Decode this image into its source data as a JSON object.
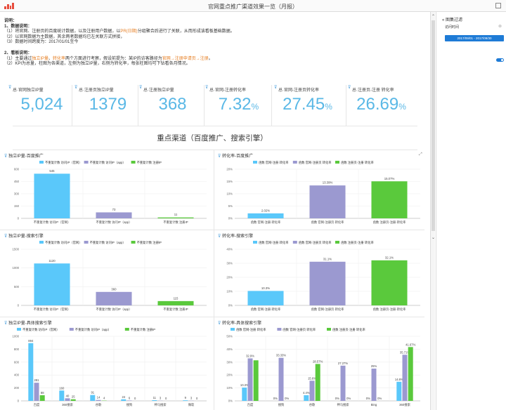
{
  "topbar": {
    "title": "官网重点推广渠道效果一览（月报）"
  },
  "sidebar": {
    "title": "图集过滤",
    "date_label": "访问时间",
    "date_value": "2017/09/01 - 2017/09/30",
    "collapse": "«",
    "clear": "⊗"
  },
  "notes": {
    "heading": "说明：",
    "l1": "1、数据说明：",
    "l2a": "（1）将官网、注册页的百度统计数据，以及注册用户数据，以",
    "l2b": "PR(日期)",
    "l2c": "分组聚合后进行了关联，从而形成该看板基础数据。",
    "l3": "（2）以官网数据为主数据，其余两者数据均已左关联方式拼接，",
    "l4": "（3）数据时间跨度为：2017/01/01至今",
    "l5": "2、看板说明：",
    "l6a": "（1）主要通过",
    "l6b": "独立IP量",
    "l6c": "、",
    "l6d": "转化率",
    "l6e": "两个方面进行考察，假设前提为：某IP的访客路径为",
    "l6f": "官网→注册申请页→注册",
    "l6g": "。",
    "l7": "（2）KPI为总量，柱图为各渠道，左侧为独立IP量，右侧为转化率，每张柱图均可下钻看各月情况。"
  },
  "kpis": [
    {
      "label": "总·官网独立IP量",
      "value": "5,024",
      "unit": ""
    },
    {
      "label": "总·注册页独立IP量",
      "value": "1379",
      "unit": ""
    },
    {
      "label": "总·注册独立IP量",
      "value": "368",
      "unit": ""
    },
    {
      "label": "总·官网-注册转化率",
      "value": "7.32",
      "unit": "%"
    },
    {
      "label": "总·官网-注册页转化率",
      "value": "27.45",
      "unit": "%"
    },
    {
      "label": "总·注册页-注册 转化率",
      "value": "26.69",
      "unit": "%"
    }
  ],
  "section_title": "重点渠道（百度推广、搜索引擎）",
  "chart_data": [
    {
      "type": "bar",
      "title": "独立IP量-百度推广",
      "categories": [
        "不重复计数 访问IP（官网）",
        "不重复计数 访问IP（app）",
        "不重复计数 注册IP"
      ],
      "series": [
        {
          "name": "不重复计数 访问IP（官网）",
          "color": "#5ac8fa",
          "values": [
            545,
            null,
            null
          ]
        },
        {
          "name": "不重复计数 访问IP（app）",
          "color": "#9b99d0",
          "values": [
            null,
            73,
            null
          ]
        },
        {
          "name": "不重复计数 注册IP",
          "color": "#5ac93c",
          "values": [
            null,
            null,
            11
          ]
        }
      ],
      "labels": [
        "545",
        "73",
        "11"
      ],
      "ylim": [
        0,
        600
      ],
      "yticks": [
        "0",
        "150",
        "300",
        "450",
        "600"
      ]
    },
    {
      "type": "bar",
      "title": "转化率-百度推广",
      "categories": [
        "函数 官网-注册 转化率",
        "函数 官网-注册页 转化率",
        "函数 注册页-注册 转化率"
      ],
      "series": [
        {
          "name": "函数 官网-注册 转化率",
          "color": "#5ac8fa",
          "values": [
            2.02,
            null,
            null
          ]
        },
        {
          "name": "函数 官网-注册页 转化率",
          "color": "#9b99d0",
          "values": [
            null,
            13.39,
            null
          ]
        },
        {
          "name": "函数 注册页-注册 转化率",
          "color": "#5ac93c",
          "values": [
            null,
            null,
            15.07
          ]
        }
      ],
      "labels": [
        "2.02%",
        "13.39%",
        "15.07%"
      ],
      "ylim": [
        0,
        20
      ],
      "yticks": [
        "0%",
        "5%",
        "10%",
        "15%",
        "20%"
      ]
    },
    {
      "type": "bar",
      "title": "独立IP量-搜索引擎",
      "categories": [
        "不重复计数 访问IP（官网）",
        "不重复计数 访问IP（app）",
        "不重复计数 注册IP"
      ],
      "series": [
        {
          "name": "不重复计数 访问IP（官网）",
          "color": "#5ac8fa",
          "values": [
            1120,
            null,
            null
          ]
        },
        {
          "name": "不重复计数 访问IP（app）",
          "color": "#9b99d0",
          "values": [
            null,
            360,
            null
          ]
        },
        {
          "name": "不重复计数 注册IP",
          "color": "#5ac93c",
          "values": [
            null,
            null,
            115
          ]
        }
      ],
      "labels": [
        "1120",
        "360",
        "115"
      ],
      "ylim": [
        0,
        1500
      ],
      "yticks": [
        "0",
        "500",
        "1000",
        "1500"
      ]
    },
    {
      "type": "bar",
      "title": "转化率-搜索引擎",
      "categories": [
        "函数 官网-注册 转化率",
        "函数 官网-注册页 转化率",
        "函数 注册页-注册 转化率"
      ],
      "series": [
        {
          "name": "函数 官网-注册 转化率",
          "color": "#5ac8fa",
          "values": [
            10.3,
            null,
            null
          ]
        },
        {
          "name": "函数 官网-注册页 转化率",
          "color": "#9b99d0",
          "values": [
            null,
            31.1,
            null
          ]
        },
        {
          "name": "函数 注册页-注册 转化率",
          "color": "#5ac93c",
          "values": [
            null,
            null,
            32.1
          ]
        }
      ],
      "labels": [
        "10.3%",
        "31.1%",
        "32.1%"
      ],
      "ylim": [
        0,
        40
      ],
      "yticks": [
        "0%",
        "10%",
        "20%",
        "30%",
        "40%"
      ]
    },
    {
      "type": "bar",
      "title": "独立IP量-具体搜索引擎",
      "categories": [
        "百度",
        "360搜索",
        "谷歌",
        "搜狗",
        "神马搜索",
        "微软"
      ],
      "series": [
        {
          "name": "不重复计数 访问IP（官网）",
          "color": "#5ac8fa",
          "values": [
            894,
            160,
            91,
            24,
            11,
            9
          ]
        },
        {
          "name": "不重复计数 访问IP（app）",
          "color": "#9b99d0",
          "values": [
            281,
            40,
            14,
            6,
            3,
            3
          ]
        },
        {
          "name": "不重复计数 注册IP",
          "color": "#5ac93c",
          "values": [
            88,
            25,
            4,
            0,
            0,
            0
          ]
        }
      ],
      "ylim": [
        0,
        1000
      ],
      "yticks": [
        "0",
        "200",
        "400",
        "600",
        "800",
        "1000"
      ]
    },
    {
      "type": "bar",
      "title": "转化率-具体搜索引擎",
      "categories": [
        "百度",
        "搜狗",
        "谷歌",
        "神马搜索",
        "Bing",
        "360搜索"
      ],
      "series": [
        {
          "name": "函数 官网-注册 转化率",
          "color": "#5ac8fa",
          "values": [
            10.3,
            0,
            4.4,
            0,
            0,
            14.8
          ]
        },
        {
          "name": "函数 官网-注册页 转化率",
          "color": "#9b99d0",
          "values": [
            32.9,
            33.33,
            15.6,
            27.27,
            25,
            35.71
          ]
        },
        {
          "name": "函数 注册页-注册 转化率",
          "color": "#5ac93c",
          "values": [
            31.4,
            0,
            28.57,
            0,
            0,
            41.67
          ]
        }
      ],
      "labels": [
        [
          "10.3%",
          "32.9%",
          ""
        ],
        [
          "0%",
          "33.33%",
          "0%"
        ],
        [
          "4.4%",
          "15.6%",
          "28.57%"
        ],
        [
          "0%",
          "27.27%",
          "0%"
        ],
        [
          "0%",
          "25%",
          "0%"
        ],
        [
          "14.8%",
          "35.71%",
          "41.67%"
        ]
      ],
      "ylim": [
        0,
        50
      ],
      "yticks": [
        "0%",
        "10%",
        "20%",
        "30%",
        "40%",
        "50%"
      ]
    }
  ]
}
